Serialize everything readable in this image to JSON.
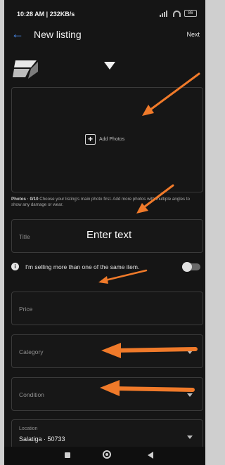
{
  "status_bar": {
    "time": "10:28 AM | 232KB/s",
    "battery": "86"
  },
  "header": {
    "title": "New listing",
    "next_label": "Next"
  },
  "photos": {
    "add_label": "Add Photos",
    "helper_count": "Photos · 0/10",
    "helper_text": "Choose your listing's main photo first. Add more photos with multiple angles to show any damage or wear."
  },
  "fields": {
    "title_label": "Title",
    "title_overlay": "Enter text",
    "multiple_items_text": "I'm selling more than one of the same item.",
    "price_label": "Price",
    "category_label": "Category",
    "condition_label": "Condition",
    "location_label": "Location",
    "location_value": "Salatiga · 50733"
  },
  "colors": {
    "accent": "#4a8df0",
    "annotation_arrow": "#f07a2a",
    "background": "#151515"
  },
  "icons": [
    "back-arrow-icon",
    "dropdown-caret-icon",
    "add-photo-icon",
    "info-icon",
    "chevron-down-icon",
    "nav-recents-icon",
    "nav-home-icon",
    "nav-back-icon"
  ]
}
